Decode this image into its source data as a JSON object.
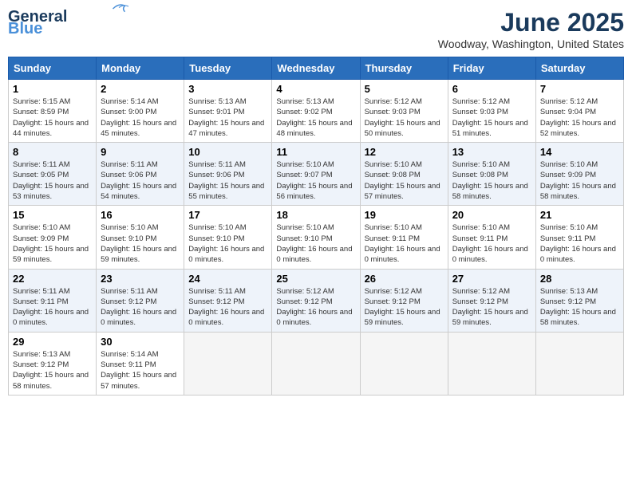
{
  "header": {
    "logo_general": "General",
    "logo_blue": "Blue",
    "month_title": "June 2025",
    "location": "Woodway, Washington, United States"
  },
  "days_of_week": [
    "Sunday",
    "Monday",
    "Tuesday",
    "Wednesday",
    "Thursday",
    "Friday",
    "Saturday"
  ],
  "weeks": [
    [
      {
        "day": "1",
        "sunrise": "5:15 AM",
        "sunset": "8:59 PM",
        "daylight": "15 hours and 44 minutes."
      },
      {
        "day": "2",
        "sunrise": "5:14 AM",
        "sunset": "9:00 PM",
        "daylight": "15 hours and 45 minutes."
      },
      {
        "day": "3",
        "sunrise": "5:13 AM",
        "sunset": "9:01 PM",
        "daylight": "15 hours and 47 minutes."
      },
      {
        "day": "4",
        "sunrise": "5:13 AM",
        "sunset": "9:02 PM",
        "daylight": "15 hours and 48 minutes."
      },
      {
        "day": "5",
        "sunrise": "5:12 AM",
        "sunset": "9:03 PM",
        "daylight": "15 hours and 50 minutes."
      },
      {
        "day": "6",
        "sunrise": "5:12 AM",
        "sunset": "9:03 PM",
        "daylight": "15 hours and 51 minutes."
      },
      {
        "day": "7",
        "sunrise": "5:12 AM",
        "sunset": "9:04 PM",
        "daylight": "15 hours and 52 minutes."
      }
    ],
    [
      {
        "day": "8",
        "sunrise": "5:11 AM",
        "sunset": "9:05 PM",
        "daylight": "15 hours and 53 minutes."
      },
      {
        "day": "9",
        "sunrise": "5:11 AM",
        "sunset": "9:06 PM",
        "daylight": "15 hours and 54 minutes."
      },
      {
        "day": "10",
        "sunrise": "5:11 AM",
        "sunset": "9:06 PM",
        "daylight": "15 hours and 55 minutes."
      },
      {
        "day": "11",
        "sunrise": "5:10 AM",
        "sunset": "9:07 PM",
        "daylight": "15 hours and 56 minutes."
      },
      {
        "day": "12",
        "sunrise": "5:10 AM",
        "sunset": "9:08 PM",
        "daylight": "15 hours and 57 minutes."
      },
      {
        "day": "13",
        "sunrise": "5:10 AM",
        "sunset": "9:08 PM",
        "daylight": "15 hours and 58 minutes."
      },
      {
        "day": "14",
        "sunrise": "5:10 AM",
        "sunset": "9:09 PM",
        "daylight": "15 hours and 58 minutes."
      }
    ],
    [
      {
        "day": "15",
        "sunrise": "5:10 AM",
        "sunset": "9:09 PM",
        "daylight": "15 hours and 59 minutes."
      },
      {
        "day": "16",
        "sunrise": "5:10 AM",
        "sunset": "9:10 PM",
        "daylight": "15 hours and 59 minutes."
      },
      {
        "day": "17",
        "sunrise": "5:10 AM",
        "sunset": "9:10 PM",
        "daylight": "16 hours and 0 minutes."
      },
      {
        "day": "18",
        "sunrise": "5:10 AM",
        "sunset": "9:10 PM",
        "daylight": "16 hours and 0 minutes."
      },
      {
        "day": "19",
        "sunrise": "5:10 AM",
        "sunset": "9:11 PM",
        "daylight": "16 hours and 0 minutes."
      },
      {
        "day": "20",
        "sunrise": "5:10 AM",
        "sunset": "9:11 PM",
        "daylight": "16 hours and 0 minutes."
      },
      {
        "day": "21",
        "sunrise": "5:10 AM",
        "sunset": "9:11 PM",
        "daylight": "16 hours and 0 minutes."
      }
    ],
    [
      {
        "day": "22",
        "sunrise": "5:11 AM",
        "sunset": "9:11 PM",
        "daylight": "16 hours and 0 minutes."
      },
      {
        "day": "23",
        "sunrise": "5:11 AM",
        "sunset": "9:12 PM",
        "daylight": "16 hours and 0 minutes."
      },
      {
        "day": "24",
        "sunrise": "5:11 AM",
        "sunset": "9:12 PM",
        "daylight": "16 hours and 0 minutes."
      },
      {
        "day": "25",
        "sunrise": "5:12 AM",
        "sunset": "9:12 PM",
        "daylight": "16 hours and 0 minutes."
      },
      {
        "day": "26",
        "sunrise": "5:12 AM",
        "sunset": "9:12 PM",
        "daylight": "15 hours and 59 minutes."
      },
      {
        "day": "27",
        "sunrise": "5:12 AM",
        "sunset": "9:12 PM",
        "daylight": "15 hours and 59 minutes."
      },
      {
        "day": "28",
        "sunrise": "5:13 AM",
        "sunset": "9:12 PM",
        "daylight": "15 hours and 58 minutes."
      }
    ],
    [
      {
        "day": "29",
        "sunrise": "5:13 AM",
        "sunset": "9:12 PM",
        "daylight": "15 hours and 58 minutes."
      },
      {
        "day": "30",
        "sunrise": "5:14 AM",
        "sunset": "9:11 PM",
        "daylight": "15 hours and 57 minutes."
      },
      null,
      null,
      null,
      null,
      null
    ]
  ]
}
